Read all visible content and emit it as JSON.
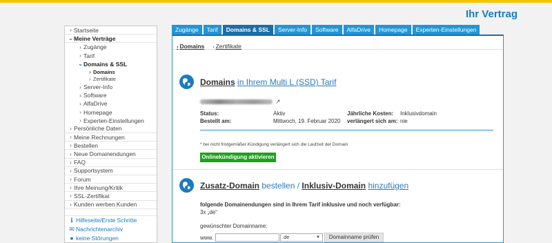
{
  "header": {
    "title": "Ihr Vertrag"
  },
  "sidebar": {
    "items": [
      {
        "label": "Startseite",
        "level": 0
      },
      {
        "label": "Meine Verträge",
        "level": 0,
        "open": true,
        "bold": true
      },
      {
        "label": "Zugänge",
        "level": 1
      },
      {
        "label": "Tarif",
        "level": 1
      },
      {
        "label": "Domains & SSL",
        "level": 1,
        "open": true,
        "bold": true
      },
      {
        "label": "Domains",
        "level": 2,
        "bold": true
      },
      {
        "label": "Zertifikate",
        "level": 2
      },
      {
        "label": "Server-Info",
        "level": 1
      },
      {
        "label": "Software",
        "level": 1
      },
      {
        "label": "AlfaDrive",
        "level": 1
      },
      {
        "label": "Homepage",
        "level": 1
      },
      {
        "label": "Experten-Einstellungen",
        "level": 1
      },
      {
        "label": "Persönliche Daten",
        "level": 0
      },
      {
        "label": "Meine Rechnungen",
        "level": 0
      },
      {
        "label": "Bestellen",
        "level": 0
      },
      {
        "label": "Neue Domainendungen",
        "level": 0
      },
      {
        "label": "FAQ",
        "level": 0
      },
      {
        "label": "Supportsystem",
        "level": 0
      },
      {
        "label": "Forum",
        "level": 0
      },
      {
        "label": "Ihre Meinung/Kritik",
        "level": 0
      },
      {
        "label": "SSL-Zertifikat",
        "level": 0
      },
      {
        "label": "Kunden werben Kunden",
        "level": 0
      }
    ],
    "help": [
      {
        "label": "Hilfeseite/Erste Schritte",
        "icon": "info-icon"
      },
      {
        "label": "Nachrichtenarchiv",
        "icon": "envelope-icon"
      },
      {
        "label": "keine Störungen",
        "icon": "status-icon"
      }
    ]
  },
  "tabs": [
    "Zugänge",
    "Tarif",
    "Domains & SSL",
    "Server-Info",
    "Software",
    "AlfaDrive",
    "Homepage",
    "Experten-Einstellungen"
  ],
  "active_tab": "Domains & SSL",
  "subtabs": [
    "Domains",
    "Zertifikate"
  ],
  "domains_section": {
    "title_bold": "Domains",
    "title_rest": "in Ihrem Multi L (SSD) Tarif",
    "status_label": "Status:",
    "status_value": "Aktiv",
    "ordered_label": "Bestellt am:",
    "ordered_value": "Mittwoch, 19. Februar 2020",
    "costs_label": "Jährliche Kosten:",
    "costs_value": "Inklusivdomain",
    "renew_label": "verlängert sich am:",
    "renew_value": "nie",
    "note": "* bei nicht fristgemäßer Kündigung verlängert sich die Laufzeit der Domain",
    "cancel_button": "Onlinekündigung aktivieren"
  },
  "addon_section": {
    "title_a": "Zusatz-Domain",
    "title_b": "bestellen /",
    "title_c": "Inklusiv-Domain",
    "title_d": "hinzufügen",
    "info": "folgende Domainendungen sind in Ihrem Tarif inklusive und noch verfügbar:",
    "count": "3x „de“",
    "desired_label": "gewünschter Domainname:",
    "prefix": "www.",
    "domain_value": "",
    "tld_selected": ".de",
    "check_button": "Domainname prüfen"
  },
  "colors": {
    "accent": "#2196d6",
    "title": "#1a7bbf",
    "green": "#1fa01f",
    "topbar": "#f5c400"
  }
}
